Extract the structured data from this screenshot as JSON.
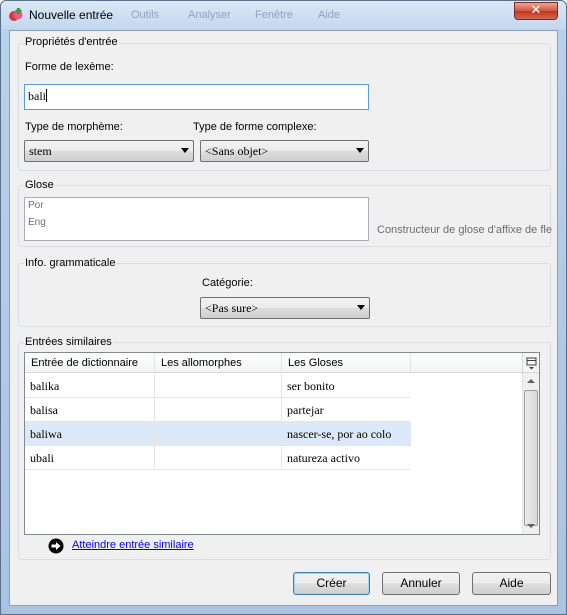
{
  "window": {
    "title": "Nouvelle entrée",
    "close_glyph": "✕",
    "ghost_menu": [
      "Outils",
      "Analyser",
      "Fenêtre",
      "Aide"
    ]
  },
  "entry_props": {
    "group_label": "Propriétés d'entrée",
    "lexeme_label": "Forme de lexème:",
    "lexeme_value": "bali",
    "morph_type_label": "Type de morphème:",
    "morph_type_value": "stem",
    "complex_type_label": "Type de forme complexe:",
    "complex_type_value": "<Sans objet>"
  },
  "gloss": {
    "group_label": "Glose",
    "ws1": "Por",
    "ws2": "Eng",
    "affix_builder": "Constructeur de glose d'affixe de fle"
  },
  "grammar": {
    "group_label": "Info. grammaticale",
    "category_label": "Catégorie:",
    "category_value": "<Pas sure>"
  },
  "similar": {
    "group_label": "Entrées similaires",
    "columns": [
      "Entrée de dictionnaire",
      "Les allomorphes",
      "Les Gloses"
    ],
    "rows": [
      {
        "entry": "balika",
        "allomorphs": "",
        "gloss": "ser bonito"
      },
      {
        "entry": "balisa",
        "allomorphs": "",
        "gloss": "partejar"
      },
      {
        "entry": "baliwa",
        "allomorphs": "",
        "gloss": "nascer-se, por ao colo"
      },
      {
        "entry": "ubali",
        "allomorphs": "",
        "gloss": "natureza activo"
      }
    ],
    "selected_row": 2,
    "goto_link": "Atteindre entrée similaire"
  },
  "buttons": {
    "create": "Créer",
    "cancel": "Annuler",
    "help": "Aide"
  },
  "colors": {
    "selection": "#dce9f8",
    "link": "#0000ee",
    "close": "#c2331b"
  }
}
